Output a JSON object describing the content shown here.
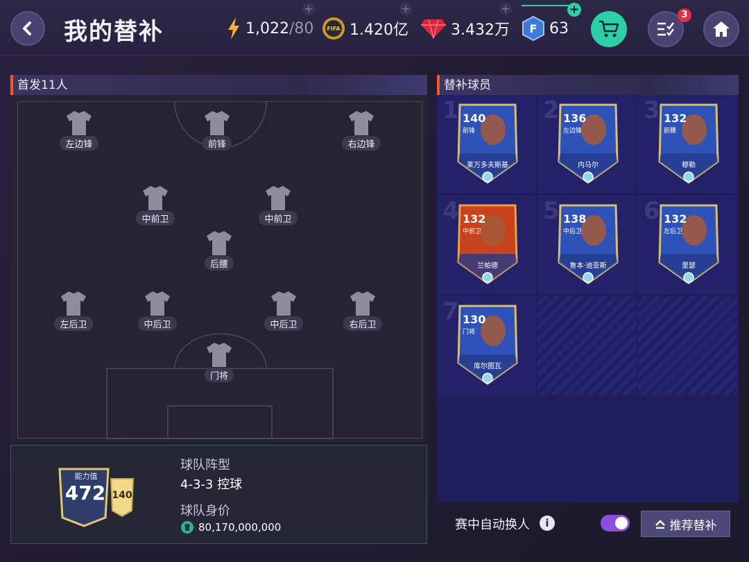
{
  "header": {
    "title": "我的替补",
    "energy": "1,022",
    "energy_max": "/80",
    "coins": "1.420亿",
    "gems": "3.432万",
    "fifa_points": "63",
    "tasks_badge": "3"
  },
  "lineup": {
    "title": "首发11人",
    "positions": {
      "lw": "左边锋",
      "st": "前锋",
      "rw": "右边锋",
      "cm_l": "中前卫",
      "cm_r": "中前卫",
      "cdm": "后腰",
      "lb": "左后卫",
      "cb_l": "中后卫",
      "cb_r": "中后卫",
      "rb": "右后卫",
      "gk": "门将"
    }
  },
  "team": {
    "rating_label": "能力值",
    "rating": "472",
    "top_player_rating": "140",
    "formation_label": "球队阵型",
    "formation": "4-3-3 控球",
    "value_label": "球队身价",
    "value": "80,170,000,000"
  },
  "subs": {
    "title": "替补球员",
    "players": [
      {
        "slot": "1",
        "rating": "140",
        "role": "前锋",
        "name": "莱万多夫斯基"
      },
      {
        "slot": "2",
        "rating": "136",
        "role": "左边锋",
        "name": "内马尔"
      },
      {
        "slot": "3",
        "rating": "132",
        "role": "前腰",
        "name": "穆勒"
      },
      {
        "slot": "4",
        "rating": "132",
        "role": "中前卫",
        "name": "兰帕德"
      },
      {
        "slot": "5",
        "rating": "138",
        "role": "中后卫",
        "name": "鲁本·迪亚斯"
      },
      {
        "slot": "6",
        "rating": "132",
        "role": "左后卫",
        "name": "里瑟"
      },
      {
        "slot": "7",
        "rating": "130",
        "role": "门将",
        "name": "库尔图瓦"
      }
    ],
    "auto_sub_label": "赛中自动换人",
    "recommend_label": "推荐替补"
  },
  "colors": {
    "accent_orange": "#f05a2a",
    "toggle_on": "#8c4ee0",
    "cart_green": "#2bd0a8",
    "panel_blue": "#1f1d5c"
  },
  "icons": [
    "back-icon",
    "energy-icon",
    "coin-icon",
    "gem-icon",
    "fifa-points-icon",
    "cart-icon",
    "tasks-icon",
    "home-icon",
    "info-icon",
    "chevron-up-icon",
    "shirt-icon"
  ]
}
